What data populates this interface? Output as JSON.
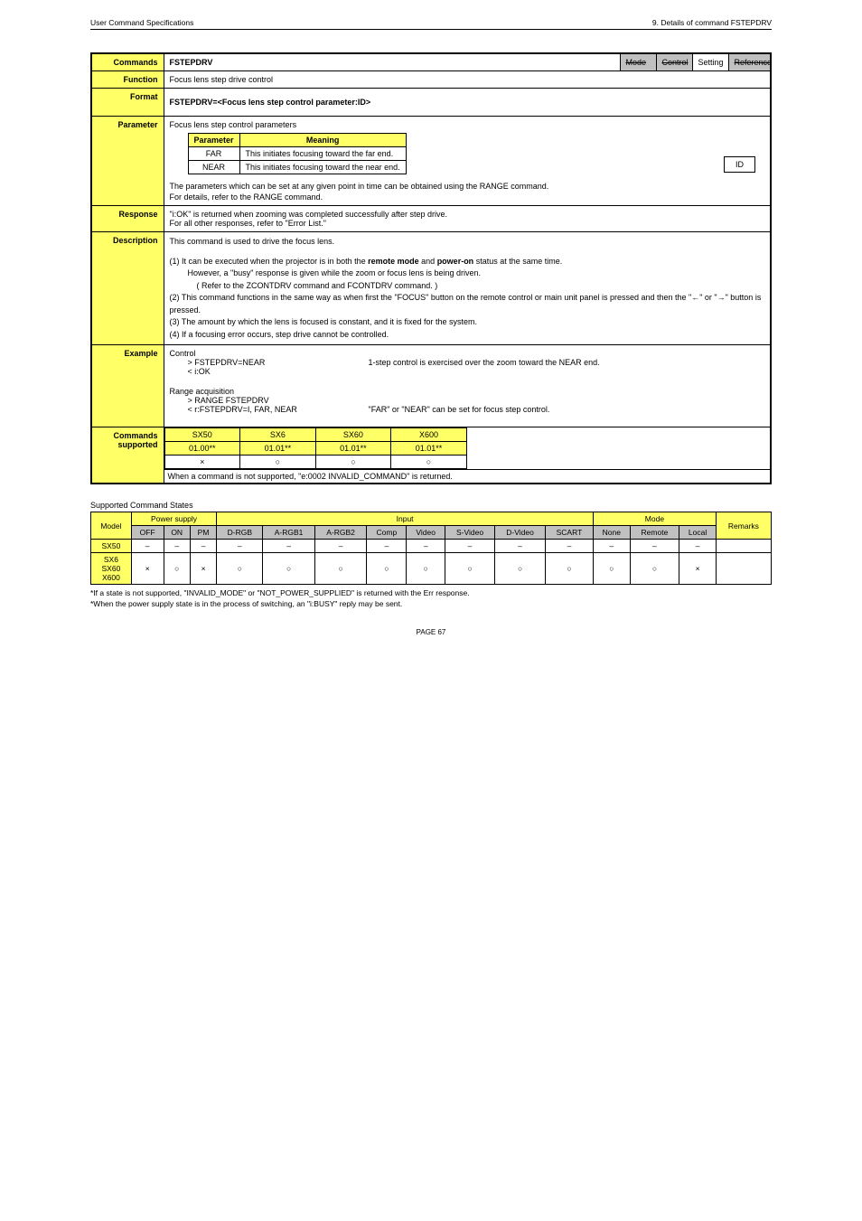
{
  "header": {
    "left": "User Command Specifications",
    "right": "9. Details of command FSTEPDRV"
  },
  "labels": {
    "commands": "Commands",
    "function": "Function",
    "format": "Format",
    "parameter": "Parameter",
    "response": "Response",
    "description": "Description",
    "example": "Example",
    "commands_supported": "Commands\nsupported"
  },
  "cmd_title": "FSTEPDRV",
  "badges": {
    "mode": "Mode",
    "control": "Control",
    "setting": "Setting",
    "reference": "Reference"
  },
  "function_text": "Focus lens step drive control",
  "format_text": "FSTEPDRV=<Focus lens step control parameter:ID>",
  "param": {
    "intro": "Focus lens step control parameters",
    "hdr_param": "Parameter",
    "hdr_mean": "Meaning",
    "r1p": "FAR",
    "r1m": "This initiates focusing toward the far end.",
    "r2p": "NEAR",
    "r2m": "This initiates focusing toward the near end.",
    "post1": "The parameters which can be set at any given point in time can be obtained using the RANGE command.",
    "post2": "For details, refer to the RANGE command.",
    "id_box": "ID"
  },
  "response": {
    "l1": "\"i:OK\" is returned when zooming was completed successfully after step drive.",
    "l2": "For all other responses, refer to \"Error List.\""
  },
  "desc": {
    "l0": "This command is used to drive the focus lens.",
    "l1": "(1) It can be executed when the projector is in both the ",
    "l1b": "remote mode",
    "l1c": " and ",
    "l1d": "power-on",
    "l1e": " status at the same time.",
    "l1f": "However, a \"busy\" response is given while the zoom or focus lens is being driven.",
    "l1g": "( Refer to the ZCONTDRV command and FCONTDRV command.  )",
    "l2": "(2) This command functions in the same way as when first the \"FOCUS\" button on the remote control or main unit panel is pressed and then the \"←\" or \"→\" button is pressed.",
    "l3": "(3) The amount by which the lens is focused is constant, and it is fixed for the system.",
    "l4": "(4) If a focusing error occurs, step drive cannot be controlled."
  },
  "example": {
    "ctrl": "Control",
    "c1": "> FSTEPDRV=NEAR",
    "c2": "< i:OK",
    "note1": "1-step control is exercised over the zoom toward the NEAR end.",
    "range_t": "Range acquisition",
    "r1": "> RANGE FSTEPDRV",
    "r2": "< r:FSTEPDRV=I, FAR, NEAR",
    "note2": "\"FAR\" or \"NEAR\" can be set for focus step control."
  },
  "cmd_supp": {
    "h1": "SX50",
    "h2": "SX6",
    "h3": "SX60",
    "h4": "X600",
    "v1": "01.00**",
    "v2": "01.01**",
    "v3": "01.01**",
    "v4": "01.01**",
    "r1": "×",
    "r2": "○",
    "r3": "○",
    "r4": "○",
    "note": "When a command is not supported, \"e:0002 INVALID_COMMAND\" is returned."
  },
  "states_title": "Supported Command States",
  "states": {
    "h_model": "Model",
    "h_power": "Power supply",
    "h_input": "Input",
    "h_mode": "Mode",
    "h_remarks": "Remarks",
    "sh_off": "OFF",
    "sh_on": "ON",
    "sh_pm": "PM",
    "sh_drgb": "D-RGB",
    "sh_argb1": "A-RGB1",
    "sh_argb2": "A-RGB2",
    "sh_comp": "Comp",
    "sh_video": "Video",
    "sh_svideo": "S-Video",
    "sh_dvideo": "D-Video",
    "sh_scart": "SCART",
    "sh_none": "None",
    "sh_remote": "Remote",
    "sh_local": "Local",
    "rows": [
      {
        "m": "SX50",
        "c": [
          "–",
          "–",
          "–",
          "–",
          "–",
          "–",
          "–",
          "–",
          "–",
          "–",
          "–",
          "–",
          "–",
          "–"
        ],
        "r": ""
      },
      {
        "m": "SX6\nSX60\nX600",
        "c": [
          "×",
          "○",
          "×",
          "○",
          "○",
          "○",
          "○",
          "○",
          "○",
          "○",
          "○",
          "○",
          "○",
          "×"
        ],
        "r": ""
      }
    ]
  },
  "foot1": "*If a state is not supported, \"INVALID_MODE\" or \"NOT_POWER_SUPPLIED\" is returned with the Err response.",
  "foot2": "*When the power supply state is in the process of switching, an \"i:BUSY\" reply may be sent.",
  "page": "PAGE 67"
}
